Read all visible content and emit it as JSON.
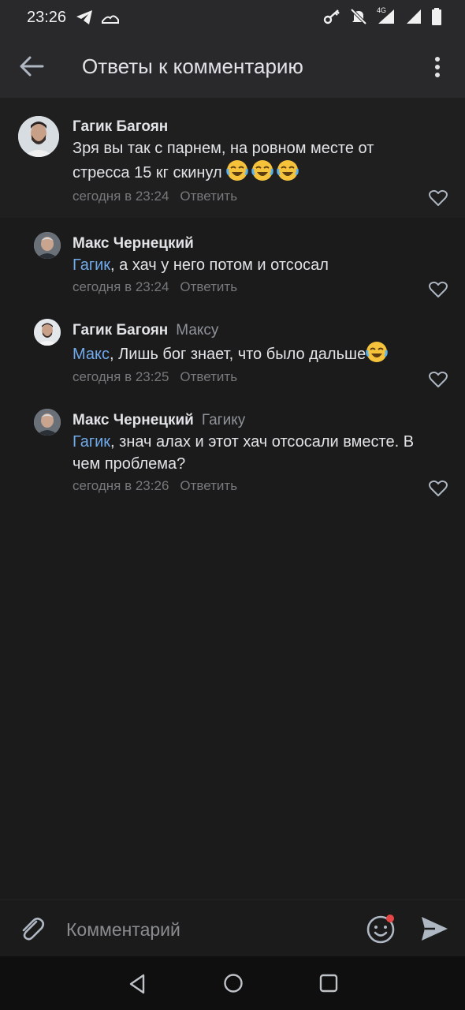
{
  "status": {
    "time": "23:26",
    "network": "4G"
  },
  "header": {
    "title": "Ответы к комментарию"
  },
  "root_comment": {
    "author": "Гагик Багоян",
    "text": "Зря вы так с парнем, на ровном месте от стресса 15 кг скинул",
    "emoji": "😂😂😂",
    "time": "сегодня в 23:24",
    "reply_label": "Ответить"
  },
  "replies": [
    {
      "author": "Макс Чернецкий",
      "reply_to": "",
      "mention": "Гагик",
      "text": ", а хач у него потом и отсосал",
      "time": "сегодня в 23:24",
      "reply_label": "Ответить"
    },
    {
      "author": "Гагик Багоян",
      "reply_to": "Максу",
      "mention": "Макс",
      "text": ", Лишь бог знает, что было дальше",
      "time": "сегодня в 23:25",
      "reply_label": "Ответить"
    },
    {
      "author": "Макс Чернецкий",
      "reply_to": "Гагику",
      "mention": "Гагик",
      "text": ", знач алах и этот хач отсосали вместе. В чем проблема?",
      "time": "сегодня в 23:26",
      "reply_label": "Ответить"
    }
  ],
  "composer": {
    "placeholder": "Комментарий"
  },
  "colors": {
    "accent": "#71aaeb",
    "background": "#1b1b1c",
    "header": "#29292b",
    "notification_dot": "#e64646"
  },
  "icons": [
    "telegram-icon",
    "notification-icon",
    "key-icon",
    "bell-muted-icon",
    "signal-icon",
    "battery-icon",
    "back-arrow-icon",
    "more-vertical-icon",
    "heart-icon",
    "paperclip-icon",
    "smile-icon",
    "send-icon",
    "nav-back-icon",
    "nav-home-icon",
    "nav-recents-icon"
  ]
}
